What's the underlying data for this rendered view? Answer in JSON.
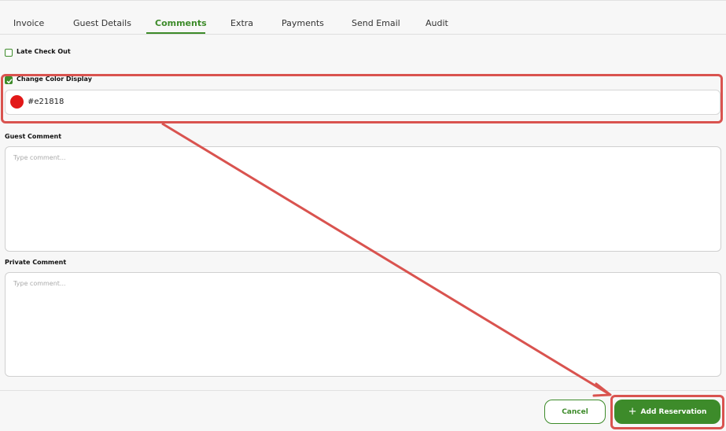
{
  "tabs": [
    {
      "label": "Invoice"
    },
    {
      "label": "Guest Details"
    },
    {
      "label": "Comments"
    },
    {
      "label": "Extra"
    },
    {
      "label": "Payments"
    },
    {
      "label": "Send Email"
    },
    {
      "label": "Audit"
    }
  ],
  "active_tab": "Comments",
  "late_checkout": {
    "label": "Late Check Out",
    "checked": false
  },
  "change_color": {
    "label": "Change Color Display",
    "checked": true,
    "value": "#e21818",
    "swatch_color": "#e21818"
  },
  "guest_comment": {
    "label": "Guest Comment",
    "placeholder": "Type comment..."
  },
  "private_comment": {
    "label": "Private Comment",
    "placeholder": "Type comment..."
  },
  "footer": {
    "cancel_label": "Cancel",
    "add_label": "Add Reservation"
  },
  "colors": {
    "accent": "#3d8b2a",
    "annotation": "#d9534f"
  }
}
